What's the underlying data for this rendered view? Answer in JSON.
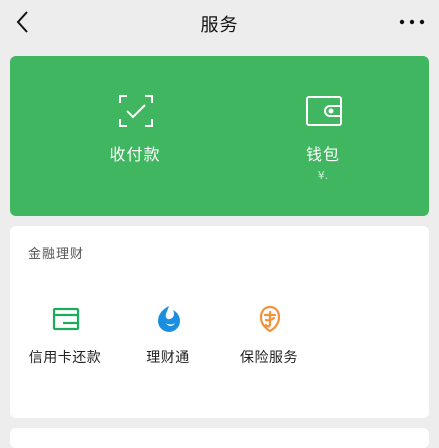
{
  "navbar": {
    "title": "服务"
  },
  "wallet_card": {
    "color": "#3fb65f",
    "pay": {
      "label": "收付款",
      "icon": "scan-check-icon"
    },
    "wallet": {
      "label": "钱包",
      "sub": "¥.",
      "icon": "wallet-icon"
    }
  },
  "finance": {
    "title": "金融理财",
    "items": [
      {
        "label": "信用卡还款",
        "icon": "credit-card-icon",
        "color": "#1aad5c"
      },
      {
        "label": "理财通",
        "icon": "licaitong-icon",
        "color": "#1a8fe0"
      },
      {
        "label": "保险服务",
        "icon": "insurance-icon",
        "color": "#f29339"
      }
    ]
  }
}
